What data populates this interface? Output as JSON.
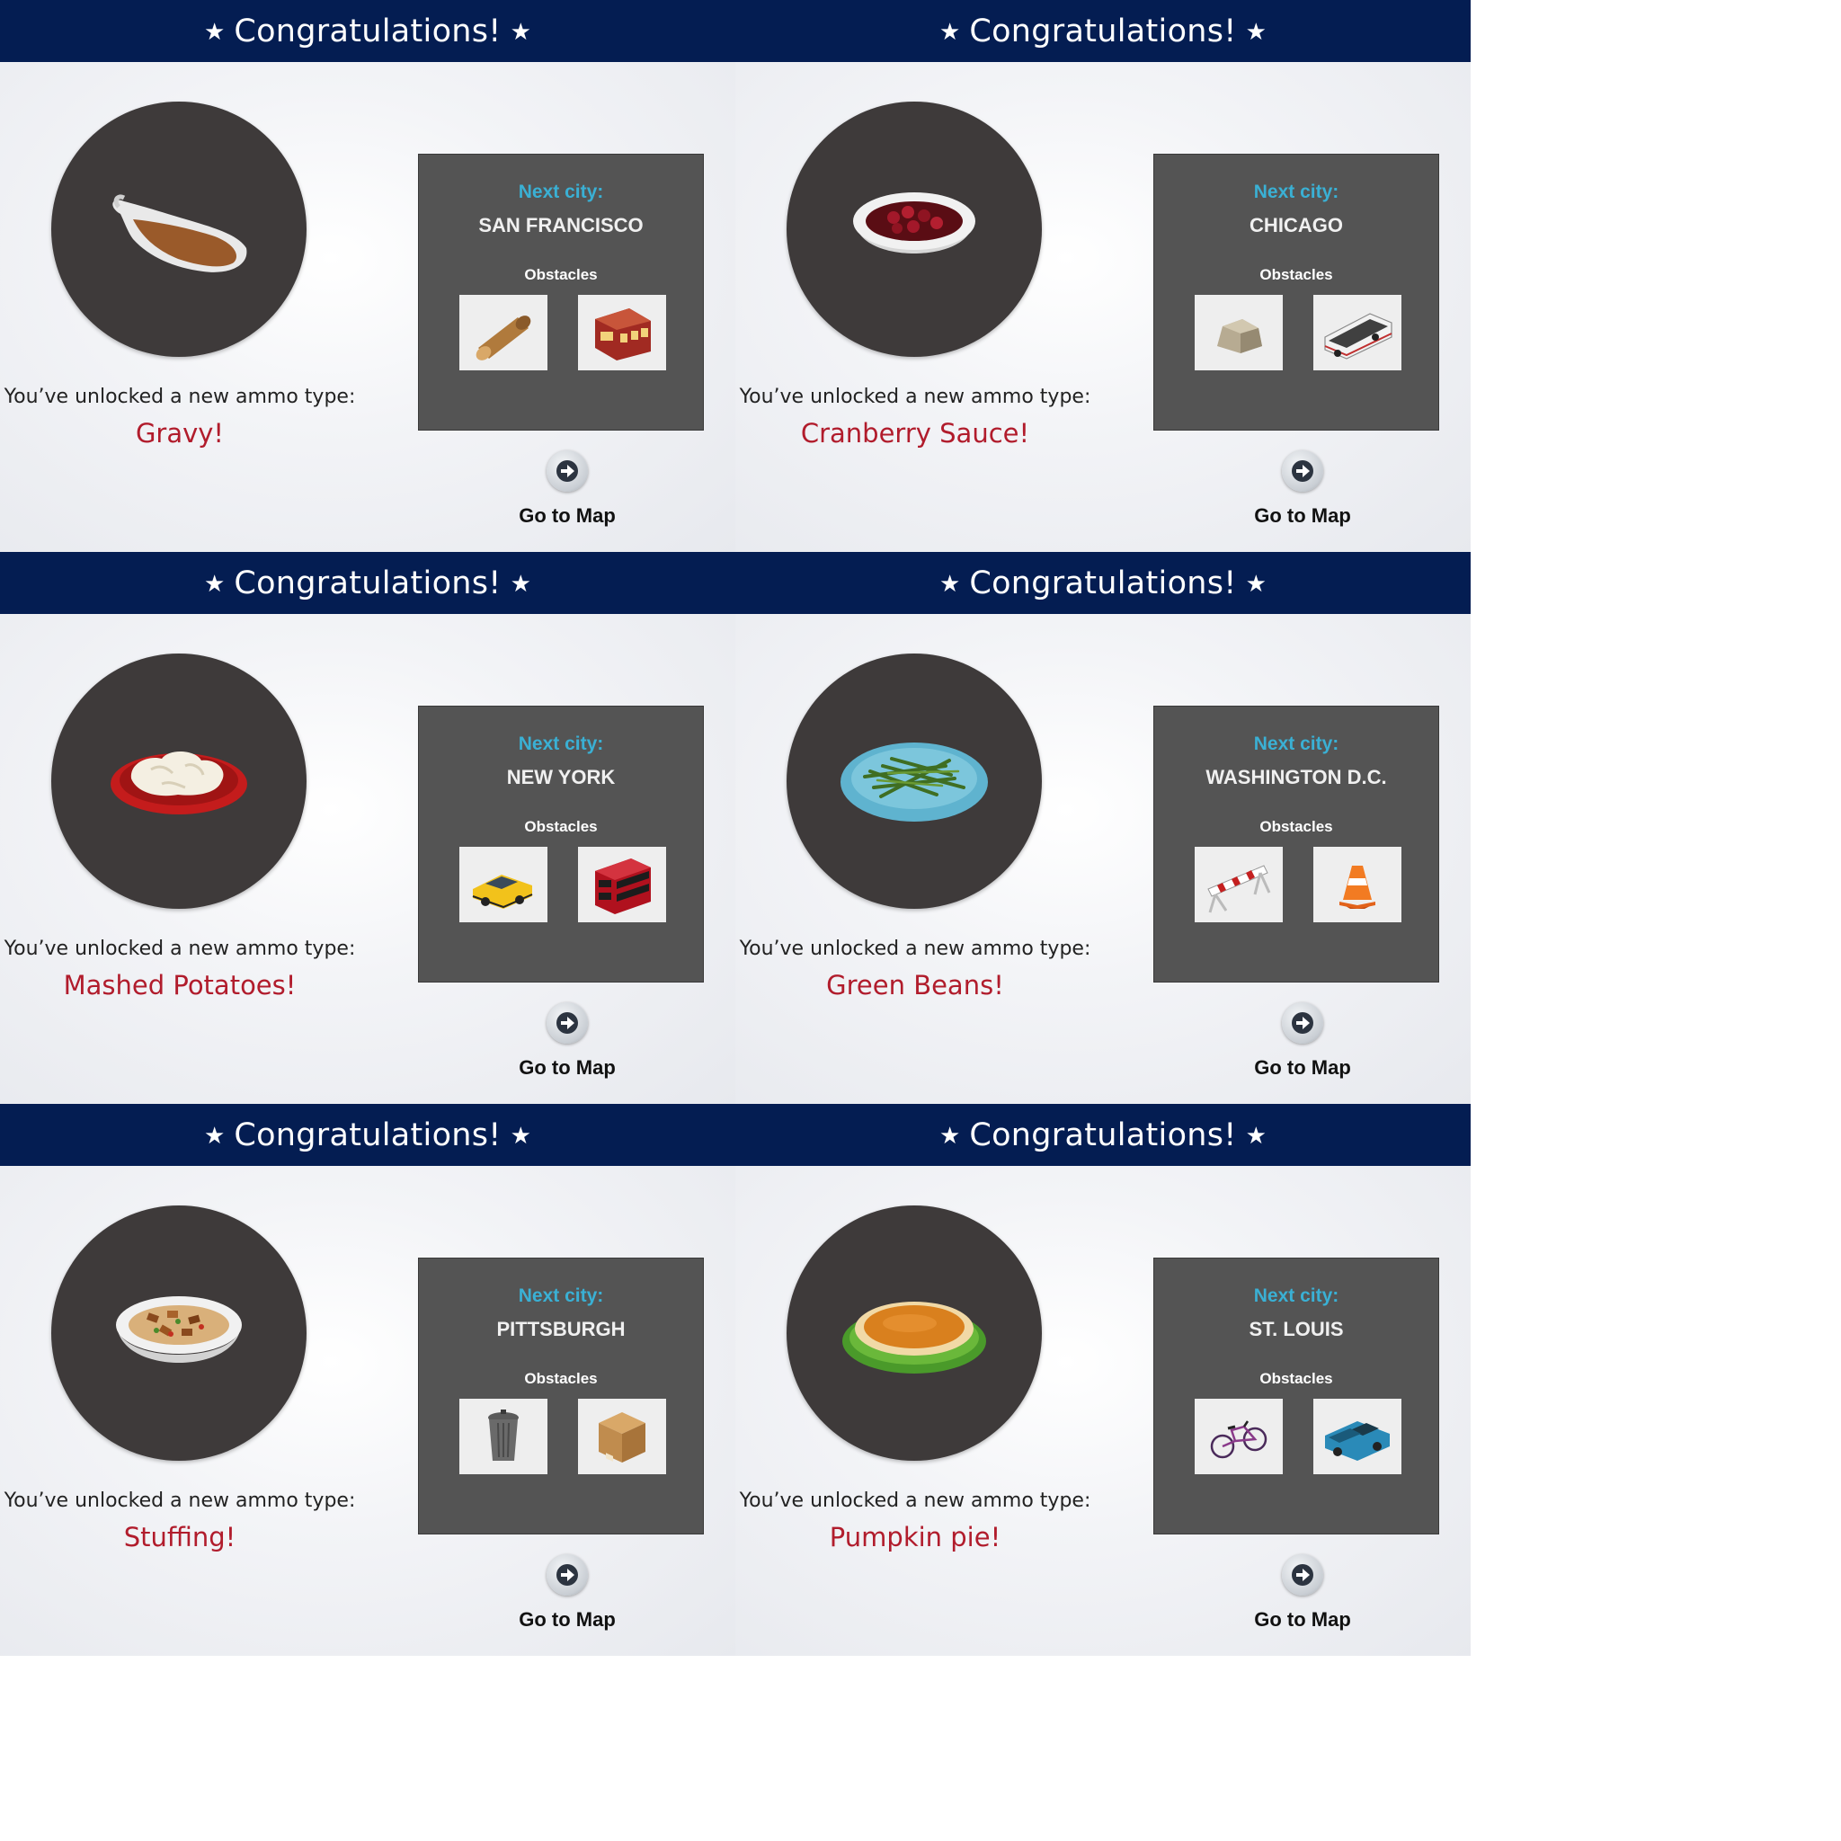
{
  "panels": [
    {
      "banner_title": "Congratulations!",
      "unlock_text": "You’ve unlocked a new ammo type:",
      "ammo_name": "Gravy!",
      "ammo_icon": "gravy-boat-icon",
      "next_city_label": "Next city:",
      "city": "SAN FRANCISCO",
      "obstacles_label": "Obstacles",
      "obstacles": [
        "log-icon",
        "cable-car-icon"
      ],
      "go_to_map": "Go to Map"
    },
    {
      "banner_title": "Congratulations!",
      "unlock_text": "You’ve unlocked a new ammo type:",
      "ammo_name": "Cranberry Sauce!",
      "ammo_icon": "cranberry-bowl-icon",
      "next_city_label": "Next city:",
      "city": "CHICAGO",
      "obstacles_label": "Obstacles",
      "obstacles": [
        "rock-icon",
        "bus-icon"
      ],
      "go_to_map": "Go to Map"
    },
    {
      "banner_title": "Congratulations!",
      "unlock_text": "You’ve unlocked a new ammo type:",
      "ammo_name": "Mashed Potatoes!",
      "ammo_icon": "mashed-potatoes-icon",
      "next_city_label": "Next city:",
      "city": "NEW YORK",
      "obstacles_label": "Obstacles",
      "obstacles": [
        "taxi-icon",
        "double-decker-bus-icon"
      ],
      "go_to_map": "Go to Map"
    },
    {
      "banner_title": "Congratulations!",
      "unlock_text": "You’ve unlocked a new ammo type:",
      "ammo_name": "Green Beans!",
      "ammo_icon": "green-beans-icon",
      "next_city_label": "Next city:",
      "city": "WASHINGTON D.C.",
      "obstacles_label": "Obstacles",
      "obstacles": [
        "barricade-icon",
        "traffic-cone-icon"
      ],
      "go_to_map": "Go to Map"
    },
    {
      "banner_title": "Congratulations!",
      "unlock_text": "You’ve unlocked a new ammo type:",
      "ammo_name": "Stuffing!",
      "ammo_icon": "stuffing-bowl-icon",
      "next_city_label": "Next city:",
      "city": "PITTSBURGH",
      "obstacles_label": "Obstacles",
      "obstacles": [
        "trash-can-icon",
        "cardboard-box-icon"
      ],
      "go_to_map": "Go to Map"
    },
    {
      "banner_title": "Congratulations!",
      "unlock_text": "You’ve unlocked a new ammo type:",
      "ammo_name": "Pumpkin pie!",
      "ammo_icon": "pumpkin-pie-icon",
      "next_city_label": "Next city:",
      "city": "ST. LOUIS",
      "obstacles_label": "Obstacles",
      "obstacles": [
        "bicycle-icon",
        "pickup-truck-icon"
      ],
      "go_to_map": "Go to Map"
    }
  ],
  "colors": {
    "banner": "#041d52",
    "ammo_name": "#b11c2c",
    "next_city": "#3ab0d4",
    "city_box": "#545454",
    "plate_circle": "#3e3a3a"
  }
}
